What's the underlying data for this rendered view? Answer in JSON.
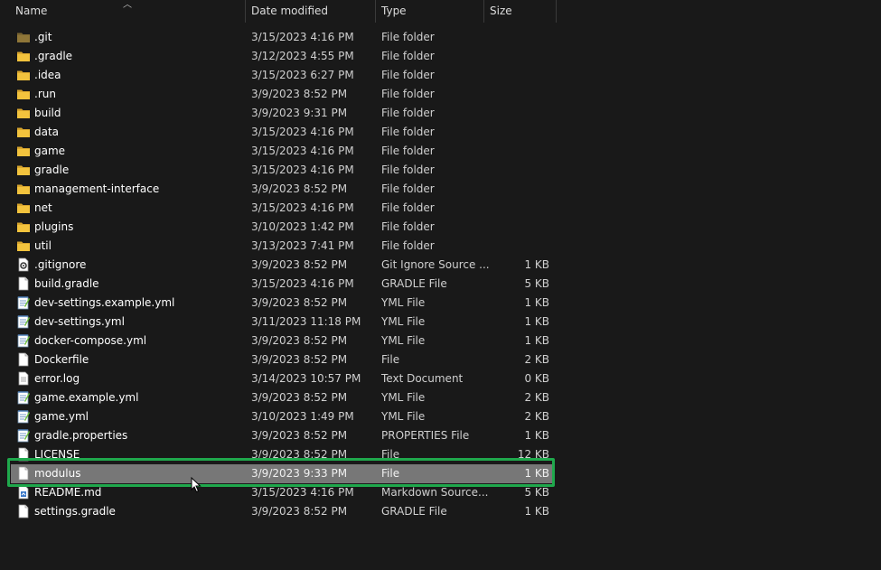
{
  "columns": {
    "name": "Name",
    "date": "Date modified",
    "type": "Type",
    "size": "Size"
  },
  "colors": {
    "background": "#191919",
    "folder": "#f3c33d",
    "selection": "#777777",
    "highlight": "#1fa84c"
  },
  "files": [
    {
      "name": ".git",
      "date": "3/15/2023 4:16 PM",
      "type": "File folder",
      "size": "",
      "icon": "folder-dim-icon"
    },
    {
      "name": ".gradle",
      "date": "3/12/2023 4:55 PM",
      "type": "File folder",
      "size": "",
      "icon": "folder-icon"
    },
    {
      "name": ".idea",
      "date": "3/15/2023 6:27 PM",
      "type": "File folder",
      "size": "",
      "icon": "folder-icon"
    },
    {
      "name": ".run",
      "date": "3/9/2023 8:52 PM",
      "type": "File folder",
      "size": "",
      "icon": "folder-icon"
    },
    {
      "name": "build",
      "date": "3/9/2023 9:31 PM",
      "type": "File folder",
      "size": "",
      "icon": "folder-icon"
    },
    {
      "name": "data",
      "date": "3/15/2023 4:16 PM",
      "type": "File folder",
      "size": "",
      "icon": "folder-icon"
    },
    {
      "name": "game",
      "date": "3/15/2023 4:16 PM",
      "type": "File folder",
      "size": "",
      "icon": "folder-icon"
    },
    {
      "name": "gradle",
      "date": "3/15/2023 4:16 PM",
      "type": "File folder",
      "size": "",
      "icon": "folder-icon"
    },
    {
      "name": "management-interface",
      "date": "3/9/2023 8:52 PM",
      "type": "File folder",
      "size": "",
      "icon": "folder-icon"
    },
    {
      "name": "net",
      "date": "3/15/2023 4:16 PM",
      "type": "File folder",
      "size": "",
      "icon": "folder-icon"
    },
    {
      "name": "plugins",
      "date": "3/10/2023 1:42 PM",
      "type": "File folder",
      "size": "",
      "icon": "folder-icon"
    },
    {
      "name": "util",
      "date": "3/13/2023 7:41 PM",
      "type": "File folder",
      "size": "",
      "icon": "folder-icon"
    },
    {
      "name": ".gitignore",
      "date": "3/9/2023 8:52 PM",
      "type": "Git Ignore Source ...",
      "size": "1 KB",
      "icon": "gear-file-icon"
    },
    {
      "name": "build.gradle",
      "date": "3/15/2023 4:16 PM",
      "type": "GRADLE File",
      "size": "5 KB",
      "icon": "file-icon"
    },
    {
      "name": "dev-settings.example.yml",
      "date": "3/9/2023 8:52 PM",
      "type": "YML File",
      "size": "1 KB",
      "icon": "notepad-file-icon"
    },
    {
      "name": "dev-settings.yml",
      "date": "3/11/2023 11:18 PM",
      "type": "YML File",
      "size": "1 KB",
      "icon": "notepad-file-icon"
    },
    {
      "name": "docker-compose.yml",
      "date": "3/9/2023 8:52 PM",
      "type": "YML File",
      "size": "1 KB",
      "icon": "notepad-file-icon"
    },
    {
      "name": "Dockerfile",
      "date": "3/9/2023 8:52 PM",
      "type": "File",
      "size": "2 KB",
      "icon": "file-icon"
    },
    {
      "name": "error.log",
      "date": "3/14/2023 10:57 PM",
      "type": "Text Document",
      "size": "0 KB",
      "icon": "text-file-icon"
    },
    {
      "name": "game.example.yml",
      "date": "3/9/2023 8:52 PM",
      "type": "YML File",
      "size": "2 KB",
      "icon": "notepad-file-icon"
    },
    {
      "name": "game.yml",
      "date": "3/10/2023 1:49 PM",
      "type": "YML File",
      "size": "2 KB",
      "icon": "notepad-file-icon"
    },
    {
      "name": "gradle.properties",
      "date": "3/9/2023 8:52 PM",
      "type": "PROPERTIES File",
      "size": "1 KB",
      "icon": "notepad-file-icon"
    },
    {
      "name": "LICENSE",
      "date": "3/9/2023 8:52 PM",
      "type": "File",
      "size": "12 KB",
      "icon": "file-icon"
    },
    {
      "name": "modulus",
      "date": "3/9/2023 9:33 PM",
      "type": "File",
      "size": "1 KB",
      "icon": "file-icon",
      "selected": true
    },
    {
      "name": "README.md",
      "date": "3/15/2023 4:16 PM",
      "type": "Markdown Source...",
      "size": "5 KB",
      "icon": "markdown-file-icon"
    },
    {
      "name": "settings.gradle",
      "date": "3/9/2023 8:52 PM",
      "type": "GRADLE File",
      "size": "1 KB",
      "icon": "file-icon"
    }
  ]
}
